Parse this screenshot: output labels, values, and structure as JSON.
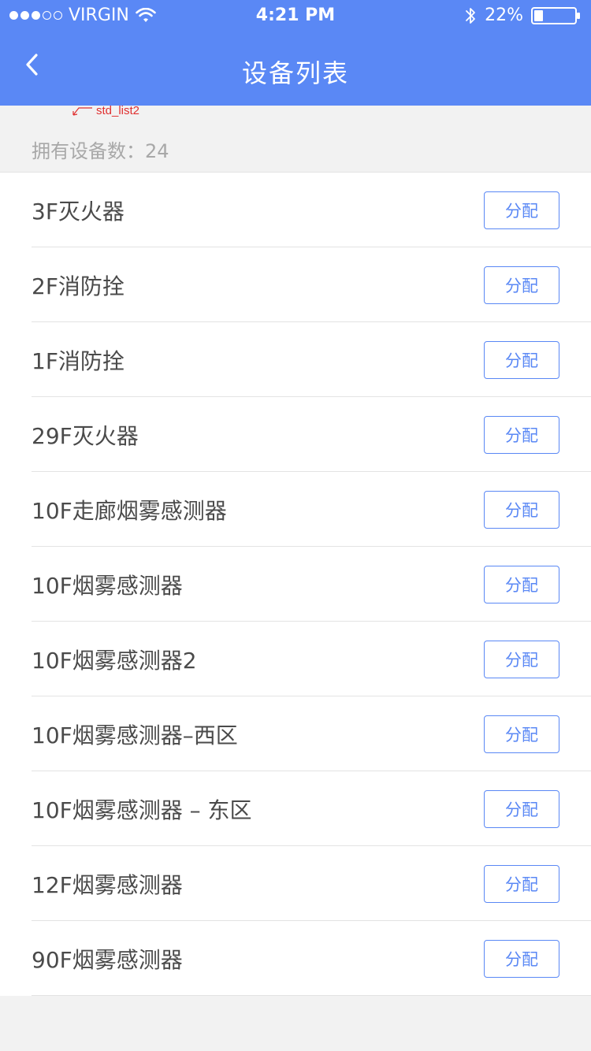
{
  "status_bar": {
    "carrier": "VIRGIN",
    "time": "4:21 PM",
    "battery": "22%",
    "battery_level": 0.22,
    "signal_strength": 3,
    "signal_max": 5
  },
  "nav": {
    "title": "设备列表",
    "back_icon": "chevron-left-icon"
  },
  "annotation": {
    "label": "std_list2"
  },
  "summary": {
    "device_count_label": "拥有设备数：24"
  },
  "colors": {
    "accent": "#5a88f5",
    "annotation": "#e03030",
    "text_primary": "#4a4a4a",
    "text_secondary": "#a8a8a8",
    "background": "#f2f2f2"
  },
  "devices": [
    {
      "name": "3F灭火器",
      "action": "分配"
    },
    {
      "name": "2F消防拴",
      "action": "分配"
    },
    {
      "name": "1F消防拴",
      "action": "分配"
    },
    {
      "name": "29F灭火器",
      "action": "分配"
    },
    {
      "name": "10F走廊烟雾感测器",
      "action": "分配"
    },
    {
      "name": "10F烟雾感测器",
      "action": "分配"
    },
    {
      "name": "10F烟雾感测器2",
      "action": "分配"
    },
    {
      "name": "10F烟雾感测器–西区",
      "action": "分配"
    },
    {
      "name": "10F烟雾感测器 – 东区",
      "action": "分配"
    },
    {
      "name": "12F烟雾感测器",
      "action": "分配"
    },
    {
      "name": "90F烟雾感测器",
      "action": "分配"
    }
  ]
}
